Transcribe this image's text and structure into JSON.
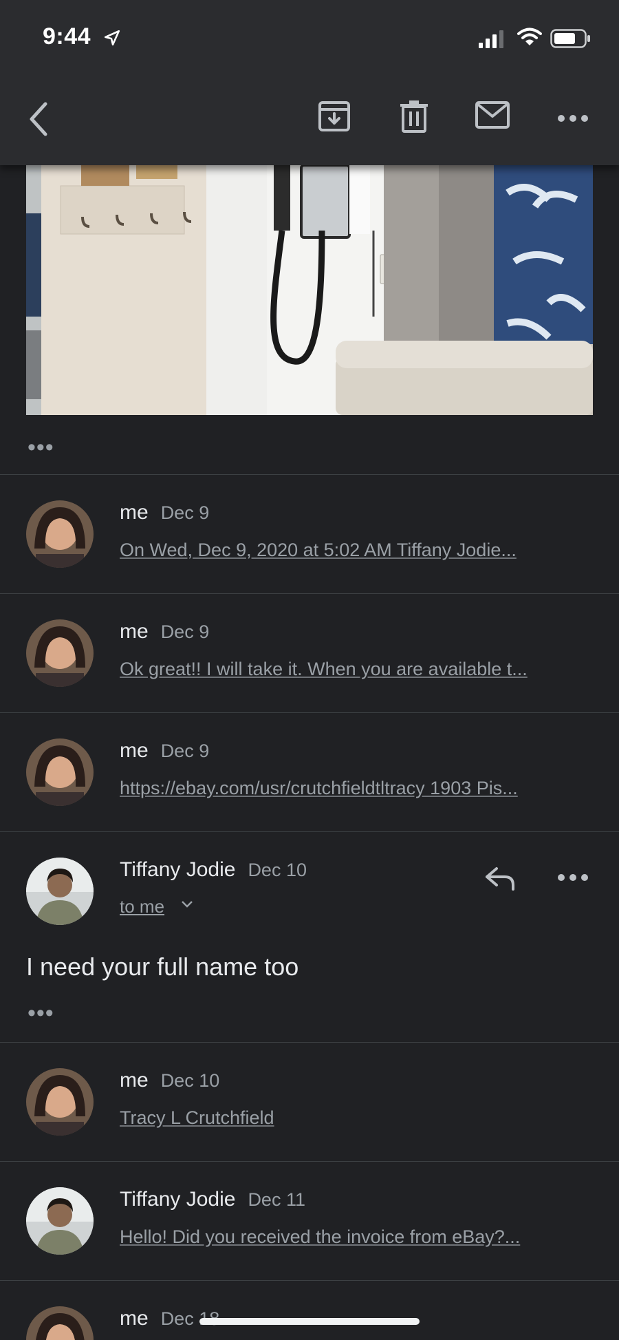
{
  "status_bar": {
    "time": "9:44"
  },
  "toolbar": {
    "back_icon": "chevron-left-icon",
    "archive_icon": "archive-icon",
    "trash_icon": "trash-icon",
    "mail_icon": "mail-icon",
    "more_icon": "more-horizontal-icon"
  },
  "expand_dots": "•••",
  "messages": [
    {
      "sender": "me",
      "date": "Dec 9",
      "snippet": "On Wed, Dec 9, 2020 at 5:02 AM Tiffany Jodie..."
    },
    {
      "sender": "me",
      "date": "Dec 9",
      "snippet": "Ok great!! I will take it. When you are available t..."
    },
    {
      "sender": "me",
      "date": "Dec 9",
      "snippet": "https://ebay.com/usr/crutchfieldtltracy 1903 Pis..."
    },
    {
      "sender": "Tiffany Jodie",
      "date": "Dec 10",
      "recipient": "to me",
      "body": "I need your full name too"
    },
    {
      "sender": "me",
      "date": "Dec 10",
      "snippet": "Tracy L Crutchfield"
    },
    {
      "sender": "Tiffany Jodie",
      "date": "Dec 11",
      "snippet": "Hello! Did you received the invoice from eBay?..."
    },
    {
      "sender": "me",
      "date": "Dec 18"
    }
  ],
  "colors": {
    "background": "#202124",
    "toolbar": "#2b2c2f",
    "text": "#e8eaed",
    "secondary": "#9aa0a6"
  }
}
